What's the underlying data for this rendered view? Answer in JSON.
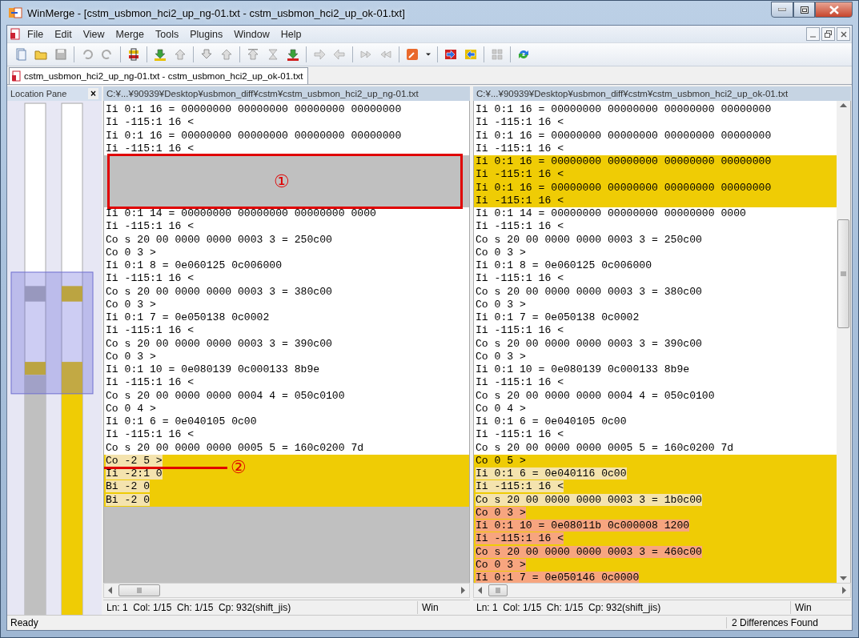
{
  "window": {
    "title": "WinMerge - [cstm_usbmon_hci2_up_ng-01.txt - cstm_usbmon_hci2_up_ok-01.txt]"
  },
  "menu": [
    "File",
    "Edit",
    "View",
    "Merge",
    "Tools",
    "Plugins",
    "Window",
    "Help"
  ],
  "tabs": [
    {
      "label": "cstm_usbmon_hci2_up_ng-01.txt - cstm_usbmon_hci2_up_ok-01.txt",
      "selected": true
    }
  ],
  "location_pane": {
    "title": "Location Pane",
    "close": "×"
  },
  "panes": [
    {
      "path": "C:¥...¥90939¥Desktop¥usbmon_diff¥cstm¥cstm_usbmon_hci2_up_ng-01.txt",
      "scrollbar": false,
      "lines": [
        {
          "kind": "same",
          "text": "Ii 0:1 16 = 00000000 00000000 00000000 00000000"
        },
        {
          "kind": "same",
          "text": "Ii -115:1 16 <"
        },
        {
          "kind": "same",
          "text": "Ii 0:1 16 = 00000000 00000000 00000000 00000000"
        },
        {
          "kind": "same",
          "text": "Ii -115:1 16 <"
        },
        {
          "kind": "gap",
          "annotation": {
            "kind": "box",
            "label": "①"
          }
        },
        {
          "kind": "gap"
        },
        {
          "kind": "gap"
        },
        {
          "kind": "gap"
        },
        {
          "kind": "same",
          "text": "Ii 0:1 14 = 00000000 00000000 00000000 0000"
        },
        {
          "kind": "same",
          "text": "Ii -115:1 16 <"
        },
        {
          "kind": "same",
          "text": "Co s 20 00 0000 0000 0003 3 = 250c00"
        },
        {
          "kind": "same",
          "text": "Co 0 3 >"
        },
        {
          "kind": "same",
          "text": "Ii 0:1 8 = 0e060125 0c006000"
        },
        {
          "kind": "same",
          "text": "Ii -115:1 16 <"
        },
        {
          "kind": "same",
          "text": "Co s 20 00 0000 0000 0003 3 = 380c00"
        },
        {
          "kind": "same",
          "text": "Co 0 3 >"
        },
        {
          "kind": "same",
          "text": "Ii 0:1 7 = 0e050138 0c0002"
        },
        {
          "kind": "same",
          "text": "Ii -115:1 16 <"
        },
        {
          "kind": "same",
          "text": "Co s 20 00 0000 0000 0003 3 = 390c00"
        },
        {
          "kind": "same",
          "text": "Co 0 3 >"
        },
        {
          "kind": "same",
          "text": "Ii 0:1 10 = 0e080139 0c000133 8b9e"
        },
        {
          "kind": "same",
          "text": "Ii -115:1 16 <"
        },
        {
          "kind": "same",
          "text": "Co s 20 00 0000 0000 0004 4 = 050c0100"
        },
        {
          "kind": "same",
          "text": "Co 0 4 >"
        },
        {
          "kind": "same",
          "text": "Ii 0:1 6 = 0e040105 0c00"
        },
        {
          "kind": "same",
          "text": "Ii -115:1 16 <"
        },
        {
          "kind": "same",
          "text": "Co s 20 00 0000 0000 0005 5 = 160c0200 7d"
        },
        {
          "kind": "diff",
          "word_diff": true,
          "line_diff": false,
          "text": "Co -2 5 >",
          "annotation": {
            "kind": "underline",
            "label": "②"
          }
        },
        {
          "kind": "diff",
          "word_diff": true,
          "line_diff": false,
          "text": "Ii -2:1 0"
        },
        {
          "kind": "diff",
          "word_diff": true,
          "line_diff": false,
          "text": "Bi -2 0"
        },
        {
          "kind": "diff",
          "word_diff": true,
          "line_diff": false,
          "text": "Bi -2 0"
        },
        {
          "kind": "gap"
        },
        {
          "kind": "gap"
        },
        {
          "kind": "gap"
        },
        {
          "kind": "gap"
        },
        {
          "kind": "gap"
        },
        {
          "kind": "gap"
        }
      ],
      "status": {
        "position": "Ln: 1  Col: 1/15  Ch: 1/15  Cp: 932(shift_jis)",
        "eol": "Win"
      }
    },
    {
      "path": "C:¥...¥90939¥Desktop¥usbmon_diff¥cstm¥cstm_usbmon_hci2_up_ok-01.txt",
      "scrollbar": true,
      "lines": [
        {
          "kind": "same",
          "text": "Ii 0:1 16 = 00000000 00000000 00000000 00000000"
        },
        {
          "kind": "same",
          "text": "Ii -115:1 16 <"
        },
        {
          "kind": "same",
          "text": "Ii 0:1 16 = 00000000 00000000 00000000 00000000"
        },
        {
          "kind": "same",
          "text": "Ii -115:1 16 <"
        },
        {
          "kind": "diff",
          "word_diff": false,
          "line_diff": false,
          "text": "Ii 0:1 16 = 00000000 00000000 00000000 00000000"
        },
        {
          "kind": "diff",
          "word_diff": false,
          "line_diff": false,
          "text": "Ii -115:1 16 <"
        },
        {
          "kind": "diff",
          "word_diff": false,
          "line_diff": false,
          "text": "Ii 0:1 16 = 00000000 00000000 00000000 00000000"
        },
        {
          "kind": "diff",
          "word_diff": false,
          "line_diff": false,
          "text": "Ii -115:1 16 <"
        },
        {
          "kind": "same",
          "text": "Ii 0:1 14 = 00000000 00000000 00000000 0000"
        },
        {
          "kind": "same",
          "text": "Ii -115:1 16 <"
        },
        {
          "kind": "same",
          "text": "Co s 20 00 0000 0000 0003 3 = 250c00"
        },
        {
          "kind": "same",
          "text": "Co 0 3 >"
        },
        {
          "kind": "same",
          "text": "Ii 0:1 8 = 0e060125 0c006000"
        },
        {
          "kind": "same",
          "text": "Ii -115:1 16 <"
        },
        {
          "kind": "same",
          "text": "Co s 20 00 0000 0000 0003 3 = 380c00"
        },
        {
          "kind": "same",
          "text": "Co 0 3 >"
        },
        {
          "kind": "same",
          "text": "Ii 0:1 7 = 0e050138 0c0002"
        },
        {
          "kind": "same",
          "text": "Ii -115:1 16 <"
        },
        {
          "kind": "same",
          "text": "Co s 20 00 0000 0000 0003 3 = 390c00"
        },
        {
          "kind": "same",
          "text": "Co 0 3 >"
        },
        {
          "kind": "same",
          "text": "Ii 0:1 10 = 0e080139 0c000133 8b9e"
        },
        {
          "kind": "same",
          "text": "Ii -115:1 16 <"
        },
        {
          "kind": "same",
          "text": "Co s 20 00 0000 0000 0004 4 = 050c0100"
        },
        {
          "kind": "same",
          "text": "Co 0 4 >"
        },
        {
          "kind": "same",
          "text": "Ii 0:1 6 = 0e040105 0c00"
        },
        {
          "kind": "same",
          "text": "Ii -115:1 16 <"
        },
        {
          "kind": "same",
          "text": "Co s 20 00 0000 0000 0005 5 = 160c0200 7d"
        },
        {
          "kind": "diff",
          "word_diff": false,
          "line_diff": false,
          "text": "Co 0 5 >"
        },
        {
          "kind": "diff",
          "word_diff": true,
          "line_diff": false,
          "text": "Ii 0:1 6 = 0e040116 0c00"
        },
        {
          "kind": "diff",
          "word_diff": true,
          "line_diff": false,
          "text": "Ii -115:1 16 <"
        },
        {
          "kind": "diff",
          "word_diff": true,
          "line_diff": false,
          "text": "Co s 20 00 0000 0000 0003 3 = 1b0c00"
        },
        {
          "kind": "diff",
          "word_diff": false,
          "line_diff": true,
          "text": "Co 0 3 >"
        },
        {
          "kind": "diff",
          "word_diff": false,
          "line_diff": true,
          "text": "Ii 0:1 10 = 0e08011b 0c000008 1200"
        },
        {
          "kind": "diff",
          "word_diff": false,
          "line_diff": true,
          "text": "Ii -115:1 16 <"
        },
        {
          "kind": "diff",
          "word_diff": false,
          "line_diff": true,
          "text": "Co s 20 00 0000 0000 0003 3 = 460c00"
        },
        {
          "kind": "diff",
          "word_diff": false,
          "line_diff": true,
          "text": "Co 0 3 >"
        },
        {
          "kind": "diff",
          "word_diff": false,
          "line_diff": true,
          "text": "Ii 0:1 7 = 0e050146 0c0000"
        }
      ],
      "status": {
        "position": "Ln: 1  Col: 1/15  Ch: 1/15  Cp: 932(shift_jis)",
        "eol": "Win"
      }
    }
  ],
  "status_bar": {
    "message": "Ready",
    "differences": "2 Differences Found"
  }
}
